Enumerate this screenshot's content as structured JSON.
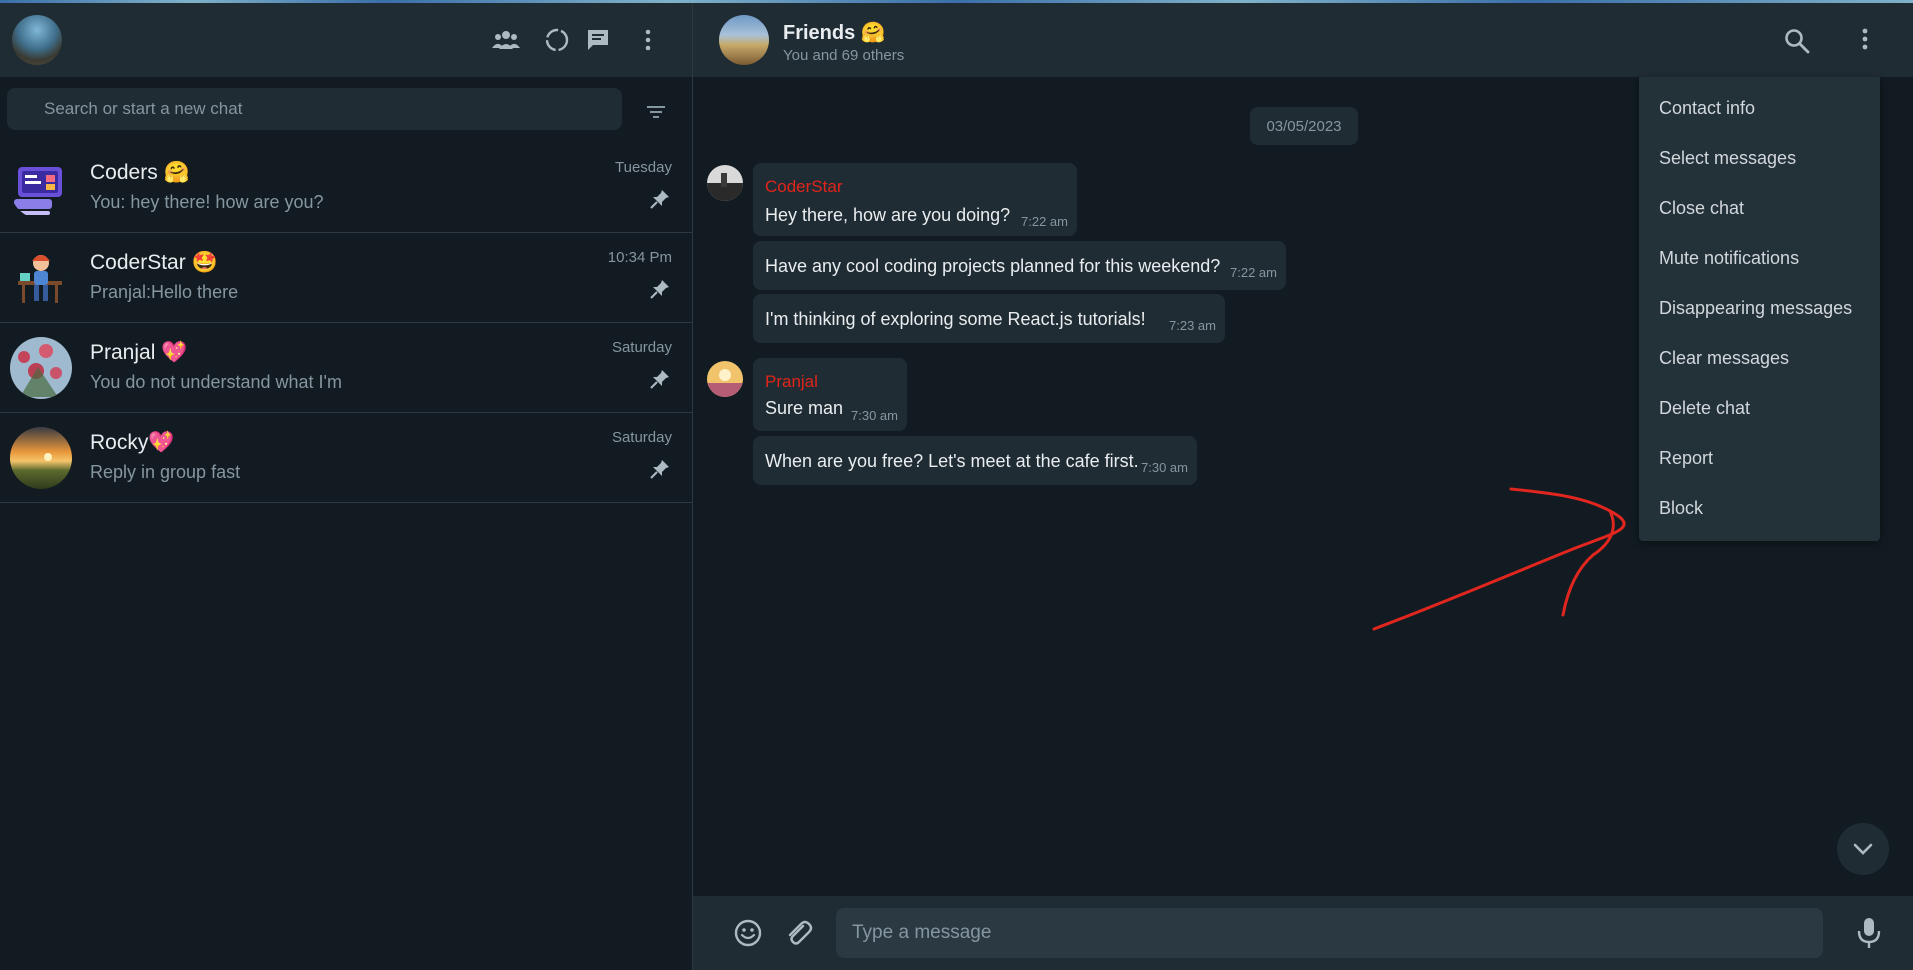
{
  "sidebar": {
    "search_placeholder": "Search or start a new chat",
    "chats": [
      {
        "name": "Coders 🤗",
        "preview": "You: hey there! how are you?",
        "time": "Tuesday"
      },
      {
        "name": "CoderStar 🤩",
        "preview": "Pranjal:Hello there",
        "time": "10:34 Pm"
      },
      {
        "name": "Pranjal 💖",
        "preview": "You do not understand what I'm",
        "time": "Saturday"
      },
      {
        "name": "Rocky💖",
        "preview": "Reply in group fast",
        "time": "Saturday"
      }
    ]
  },
  "conversation": {
    "title": "Friends 🤗",
    "subtitle": "You and 69 others",
    "date_chip": "03/05/2023",
    "messages": [
      {
        "sender": "CoderStar",
        "text": "Hey there, how are you doing?",
        "time": "7:22 am"
      },
      {
        "sender": "",
        "text": "Have any cool coding projects planned for this weekend?",
        "time": "7:22 am"
      },
      {
        "sender": "",
        "text": "I'm thinking of exploring some React.js tutorials!",
        "time": "7:23 am"
      },
      {
        "sender": "Pranjal",
        "text": "Sure man",
        "time": "7:30 am"
      },
      {
        "sender": "",
        "text": "When are you free? Let's meet at the cafe first.",
        "time": "7:30 am"
      }
    ],
    "input_placeholder": "Type a message"
  },
  "menu": {
    "items": [
      "Contact info",
      "Select messages",
      "Close chat",
      "Mute notifications",
      "Disappearing messages",
      "Clear messages",
      "Delete chat",
      "Report",
      "Block"
    ]
  },
  "icons": {
    "header": [
      "community-icon",
      "status-icon",
      "new-chat-icon",
      "menu-icon"
    ],
    "chat_header": [
      "search-icon",
      "menu-icon"
    ]
  },
  "colors": {
    "background": "#111b21",
    "panel": "#202c33",
    "sender_name": "#e0251b",
    "annotation": "#e0261e"
  }
}
